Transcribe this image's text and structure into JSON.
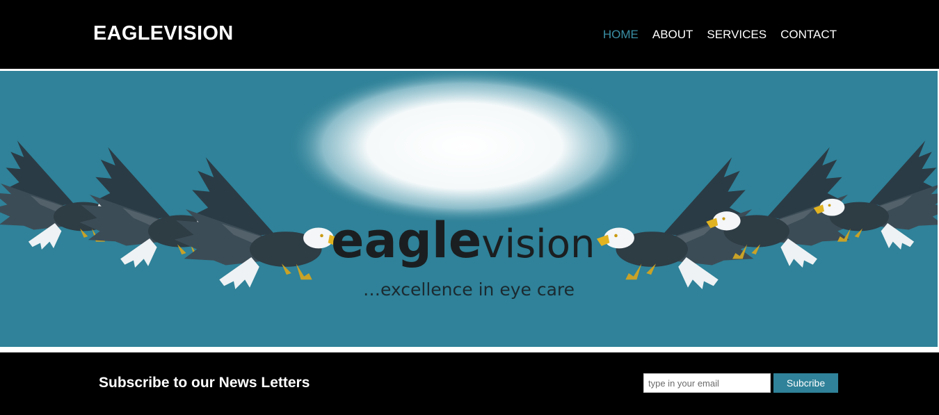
{
  "header": {
    "brand": "EAGLEVISION",
    "nav": [
      {
        "label": "HOME",
        "active": true
      },
      {
        "label": "ABOUT",
        "active": false
      },
      {
        "label": "SERVICES",
        "active": false
      },
      {
        "label": "CONTACT",
        "active": false
      }
    ],
    "active_color": "#3a8fa5"
  },
  "hero": {
    "logo_bold": "eagle",
    "logo_light": "vision",
    "tagline": "…excellence in eye care",
    "background_color": "#2f8299",
    "illustration": "bald-eagles-flying"
  },
  "newsletter": {
    "title": "Subscribe to our News Letters",
    "email_placeholder": "type in your email",
    "button_label": "Subcribe",
    "button_color": "#2f8299"
  }
}
